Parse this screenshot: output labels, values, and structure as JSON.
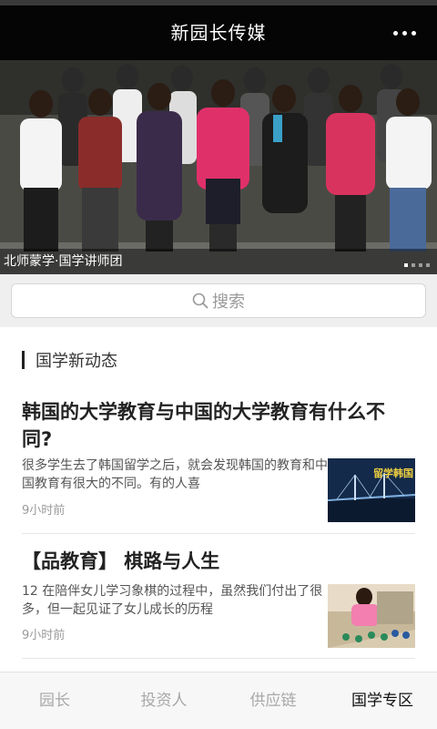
{
  "header": {
    "title": "新园长传媒",
    "menu_icon": "more-dots-icon"
  },
  "banner": {
    "caption": "北师蒙学·国学讲师团",
    "slide_count": 4,
    "active_slide": 1
  },
  "search": {
    "placeholder": "搜索",
    "icon": "search-icon"
  },
  "feed": {
    "section_title": "国学新动态",
    "articles": [
      {
        "title": "韩国的大学教育与中国的大学教育有什么不同?",
        "summary": "很多学生去了韩国留学之后，就会发现韩国的教育和中国教育有很大的不同。有的人喜",
        "time": "9小时前",
        "thumb_text": "留学韩国"
      },
      {
        "title": "【品教育】 棋路与人生",
        "summary": "12 在陪伴女儿学习象棋的过程中，虽然我们付出了很多，但一起见证了女儿成长的历程",
        "time": "9小时前"
      }
    ]
  },
  "tabbar": {
    "tabs": [
      {
        "label": "园长"
      },
      {
        "label": "投资人"
      },
      {
        "label": "供应链"
      },
      {
        "label": "国学专区"
      }
    ],
    "active_index": 3
  },
  "colors": {
    "topbar_bg": "#050505",
    "active_tab": "#111111",
    "inactive_tab": "#a8a8a8"
  }
}
